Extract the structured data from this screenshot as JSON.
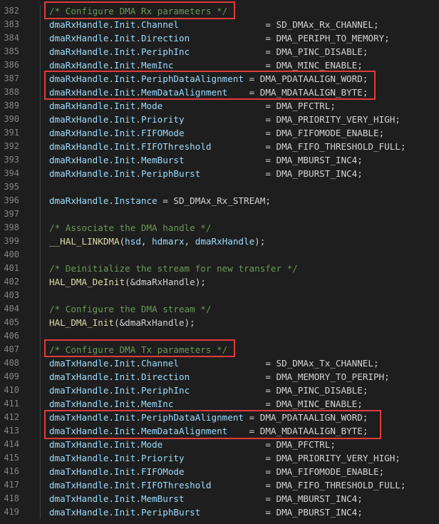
{
  "highlight_color": "#e03b3b",
  "lines": [
    {
      "n": "382",
      "tokens": [
        {
          "t": "/* Configure DMA Rx parameters */",
          "c": "comment"
        }
      ]
    },
    {
      "n": "383",
      "tokens": [
        {
          "t": "dmaRxHandle",
          "c": "var"
        },
        {
          "t": ".",
          "c": "text"
        },
        {
          "t": "Init",
          "c": "var"
        },
        {
          "t": ".",
          "c": "text"
        },
        {
          "t": "Channel",
          "c": "var"
        },
        {
          "t": "                = SD_DMAx_Rx_CHANNEL;",
          "c": "text"
        }
      ]
    },
    {
      "n": "384",
      "tokens": [
        {
          "t": "dmaRxHandle",
          "c": "var"
        },
        {
          "t": ".",
          "c": "text"
        },
        {
          "t": "Init",
          "c": "var"
        },
        {
          "t": ".",
          "c": "text"
        },
        {
          "t": "Direction",
          "c": "var"
        },
        {
          "t": "              = DMA_PERIPH_TO_MEMORY;",
          "c": "text"
        }
      ]
    },
    {
      "n": "385",
      "tokens": [
        {
          "t": "dmaRxHandle",
          "c": "var"
        },
        {
          "t": ".",
          "c": "text"
        },
        {
          "t": "Init",
          "c": "var"
        },
        {
          "t": ".",
          "c": "text"
        },
        {
          "t": "PeriphInc",
          "c": "var"
        },
        {
          "t": "              = DMA_PINC_DISABLE;",
          "c": "text"
        }
      ]
    },
    {
      "n": "386",
      "tokens": [
        {
          "t": "dmaRxHandle",
          "c": "var"
        },
        {
          "t": ".",
          "c": "text"
        },
        {
          "t": "Init",
          "c": "var"
        },
        {
          "t": ".",
          "c": "text"
        },
        {
          "t": "MemInc",
          "c": "var"
        },
        {
          "t": "                 = DMA_MINC_ENABLE;",
          "c": "text"
        }
      ]
    },
    {
      "n": "387",
      "tokens": [
        {
          "t": "dmaRxHandle",
          "c": "var"
        },
        {
          "t": ".",
          "c": "text"
        },
        {
          "t": "Init",
          "c": "var"
        },
        {
          "t": ".",
          "c": "text"
        },
        {
          "t": "PeriphDataAlignment",
          "c": "var"
        },
        {
          "t": " = DMA_PDATAALIGN_WORD;",
          "c": "text"
        }
      ]
    },
    {
      "n": "388",
      "tokens": [
        {
          "t": "dmaRxHandle",
          "c": "var"
        },
        {
          "t": ".",
          "c": "text"
        },
        {
          "t": "Init",
          "c": "var"
        },
        {
          "t": ".",
          "c": "text"
        },
        {
          "t": "MemDataAlignment",
          "c": "var"
        },
        {
          "t": "    = DMA_MDATAALIGN_BYTE;",
          "c": "text"
        }
      ]
    },
    {
      "n": "389",
      "tokens": [
        {
          "t": "dmaRxHandle",
          "c": "var"
        },
        {
          "t": ".",
          "c": "text"
        },
        {
          "t": "Init",
          "c": "var"
        },
        {
          "t": ".",
          "c": "text"
        },
        {
          "t": "Mode",
          "c": "var"
        },
        {
          "t": "                   = DMA_PFCTRL;",
          "c": "text"
        }
      ]
    },
    {
      "n": "390",
      "tokens": [
        {
          "t": "dmaRxHandle",
          "c": "var"
        },
        {
          "t": ".",
          "c": "text"
        },
        {
          "t": "Init",
          "c": "var"
        },
        {
          "t": ".",
          "c": "text"
        },
        {
          "t": "Priority",
          "c": "var"
        },
        {
          "t": "               = DMA_PRIORITY_VERY_HIGH;",
          "c": "text"
        }
      ]
    },
    {
      "n": "391",
      "tokens": [
        {
          "t": "dmaRxHandle",
          "c": "var"
        },
        {
          "t": ".",
          "c": "text"
        },
        {
          "t": "Init",
          "c": "var"
        },
        {
          "t": ".",
          "c": "text"
        },
        {
          "t": "FIFOMode",
          "c": "var"
        },
        {
          "t": "               = DMA_FIFOMODE_ENABLE;",
          "c": "text"
        }
      ]
    },
    {
      "n": "392",
      "tokens": [
        {
          "t": "dmaRxHandle",
          "c": "var"
        },
        {
          "t": ".",
          "c": "text"
        },
        {
          "t": "Init",
          "c": "var"
        },
        {
          "t": ".",
          "c": "text"
        },
        {
          "t": "FIFOThreshold",
          "c": "var"
        },
        {
          "t": "          = DMA_FIFO_THRESHOLD_FULL;",
          "c": "text"
        }
      ]
    },
    {
      "n": "393",
      "tokens": [
        {
          "t": "dmaRxHandle",
          "c": "var"
        },
        {
          "t": ".",
          "c": "text"
        },
        {
          "t": "Init",
          "c": "var"
        },
        {
          "t": ".",
          "c": "text"
        },
        {
          "t": "MemBurst",
          "c": "var"
        },
        {
          "t": "               = DMA_MBURST_INC4;",
          "c": "text"
        }
      ]
    },
    {
      "n": "394",
      "tokens": [
        {
          "t": "dmaRxHandle",
          "c": "var"
        },
        {
          "t": ".",
          "c": "text"
        },
        {
          "t": "Init",
          "c": "var"
        },
        {
          "t": ".",
          "c": "text"
        },
        {
          "t": "PeriphBurst",
          "c": "var"
        },
        {
          "t": "            = DMA_PBURST_INC4;",
          "c": "text"
        }
      ]
    },
    {
      "n": "395",
      "tokens": []
    },
    {
      "n": "396",
      "tokens": [
        {
          "t": "dmaRxHandle",
          "c": "var"
        },
        {
          "t": ".",
          "c": "text"
        },
        {
          "t": "Instance",
          "c": "var"
        },
        {
          "t": " = SD_DMAx_Rx_STREAM;",
          "c": "text"
        }
      ]
    },
    {
      "n": "397",
      "tokens": []
    },
    {
      "n": "398",
      "tokens": [
        {
          "t": "/* Associate the DMA handle */",
          "c": "comment"
        }
      ]
    },
    {
      "n": "399",
      "tokens": [
        {
          "t": "__HAL_LINKDMA",
          "c": "func"
        },
        {
          "t": "(",
          "c": "text"
        },
        {
          "t": "hsd",
          "c": "var"
        },
        {
          "t": ", ",
          "c": "text"
        },
        {
          "t": "hdmarx",
          "c": "var"
        },
        {
          "t": ", ",
          "c": "text"
        },
        {
          "t": "dmaRxHandle",
          "c": "var"
        },
        {
          "t": ");",
          "c": "text"
        }
      ]
    },
    {
      "n": "400",
      "tokens": []
    },
    {
      "n": "401",
      "tokens": [
        {
          "t": "/* Deinitialize the stream for new transfer */",
          "c": "comment"
        }
      ]
    },
    {
      "n": "402",
      "tokens": [
        {
          "t": "HAL_DMA_DeInit",
          "c": "func"
        },
        {
          "t": "(&dmaRxHandle);",
          "c": "text"
        }
      ]
    },
    {
      "n": "403",
      "tokens": []
    },
    {
      "n": "404",
      "tokens": [
        {
          "t": "/* Configure the DMA stream */",
          "c": "comment"
        }
      ]
    },
    {
      "n": "405",
      "tokens": [
        {
          "t": "HAL_DMA_Init",
          "c": "func"
        },
        {
          "t": "(&dmaRxHandle);",
          "c": "text"
        }
      ]
    },
    {
      "n": "406",
      "tokens": []
    },
    {
      "n": "407",
      "tokens": [
        {
          "t": "/* Configure DMA Tx parameters */",
          "c": "comment"
        }
      ]
    },
    {
      "n": "408",
      "tokens": [
        {
          "t": "dmaTxHandle",
          "c": "var"
        },
        {
          "t": ".",
          "c": "text"
        },
        {
          "t": "Init",
          "c": "var"
        },
        {
          "t": ".",
          "c": "text"
        },
        {
          "t": "Channel",
          "c": "var"
        },
        {
          "t": "                = SD_DMAx_Tx_CHANNEL;",
          "c": "text"
        }
      ]
    },
    {
      "n": "409",
      "tokens": [
        {
          "t": "dmaTxHandle",
          "c": "var"
        },
        {
          "t": ".",
          "c": "text"
        },
        {
          "t": "Init",
          "c": "var"
        },
        {
          "t": ".",
          "c": "text"
        },
        {
          "t": "Direction",
          "c": "var"
        },
        {
          "t": "              = DMA_MEMORY_TO_PERIPH;",
          "c": "text"
        }
      ]
    },
    {
      "n": "410",
      "tokens": [
        {
          "t": "dmaTxHandle",
          "c": "var"
        },
        {
          "t": ".",
          "c": "text"
        },
        {
          "t": "Init",
          "c": "var"
        },
        {
          "t": ".",
          "c": "text"
        },
        {
          "t": "PeriphInc",
          "c": "var"
        },
        {
          "t": "              = DMA_PINC_DISABLE;",
          "c": "text"
        }
      ]
    },
    {
      "n": "411",
      "tokens": [
        {
          "t": "dmaTxHandle",
          "c": "var"
        },
        {
          "t": ".",
          "c": "text"
        },
        {
          "t": "Init",
          "c": "var"
        },
        {
          "t": ".",
          "c": "text"
        },
        {
          "t": "MemInc",
          "c": "var"
        },
        {
          "t": "                 = DMA_MINC_ENABLE;",
          "c": "text"
        }
      ]
    },
    {
      "n": "412",
      "tokens": [
        {
          "t": "dmaTxHandle",
          "c": "var"
        },
        {
          "t": ".",
          "c": "text"
        },
        {
          "t": "Init",
          "c": "var"
        },
        {
          "t": ".",
          "c": "text"
        },
        {
          "t": "PeriphDataAlignment",
          "c": "var"
        },
        {
          "t": " = DMA_PDATAALIGN_WORD;",
          "c": "text"
        }
      ]
    },
    {
      "n": "413",
      "tokens": [
        {
          "t": "dmaTxHandle",
          "c": "var"
        },
        {
          "t": ".",
          "c": "text"
        },
        {
          "t": "Init",
          "c": "var"
        },
        {
          "t": ".",
          "c": "text"
        },
        {
          "t": "MemDataAlignment",
          "c": "var"
        },
        {
          "t": "    = DMA_MDATAALIGN_BYTE;",
          "c": "text"
        }
      ]
    },
    {
      "n": "414",
      "tokens": [
        {
          "t": "dmaTxHandle",
          "c": "var"
        },
        {
          "t": ".",
          "c": "text"
        },
        {
          "t": "Init",
          "c": "var"
        },
        {
          "t": ".",
          "c": "text"
        },
        {
          "t": "Mode",
          "c": "var"
        },
        {
          "t": "                   = DMA_PFCTRL;",
          "c": "text"
        }
      ]
    },
    {
      "n": "415",
      "tokens": [
        {
          "t": "dmaTxHandle",
          "c": "var"
        },
        {
          "t": ".",
          "c": "text"
        },
        {
          "t": "Init",
          "c": "var"
        },
        {
          "t": ".",
          "c": "text"
        },
        {
          "t": "Priority",
          "c": "var"
        },
        {
          "t": "               = DMA_PRIORITY_VERY_HIGH;",
          "c": "text"
        }
      ]
    },
    {
      "n": "416",
      "tokens": [
        {
          "t": "dmaTxHandle",
          "c": "var"
        },
        {
          "t": ".",
          "c": "text"
        },
        {
          "t": "Init",
          "c": "var"
        },
        {
          "t": ".",
          "c": "text"
        },
        {
          "t": "FIFOMode",
          "c": "var"
        },
        {
          "t": "               = DMA_FIFOMODE_ENABLE;",
          "c": "text"
        }
      ]
    },
    {
      "n": "417",
      "tokens": [
        {
          "t": "dmaTxHandle",
          "c": "var"
        },
        {
          "t": ".",
          "c": "text"
        },
        {
          "t": "Init",
          "c": "var"
        },
        {
          "t": ".",
          "c": "text"
        },
        {
          "t": "FIFOThreshold",
          "c": "var"
        },
        {
          "t": "          = DMA_FIFO_THRESHOLD_FULL;",
          "c": "text"
        }
      ]
    },
    {
      "n": "418",
      "tokens": [
        {
          "t": "dmaTxHandle",
          "c": "var"
        },
        {
          "t": ".",
          "c": "text"
        },
        {
          "t": "Init",
          "c": "var"
        },
        {
          "t": ".",
          "c": "text"
        },
        {
          "t": "MemBurst",
          "c": "var"
        },
        {
          "t": "               = DMA_MBURST_INC4;",
          "c": "text"
        }
      ]
    },
    {
      "n": "419",
      "tokens": [
        {
          "t": "dmaTxHandle",
          "c": "var"
        },
        {
          "t": ".",
          "c": "text"
        },
        {
          "t": "Init",
          "c": "var"
        },
        {
          "t": ".",
          "c": "text"
        },
        {
          "t": "PeriphBurst",
          "c": "var"
        },
        {
          "t": "            = DMA_PBURST_INC4;",
          "c": "text"
        }
      ]
    }
  ]
}
